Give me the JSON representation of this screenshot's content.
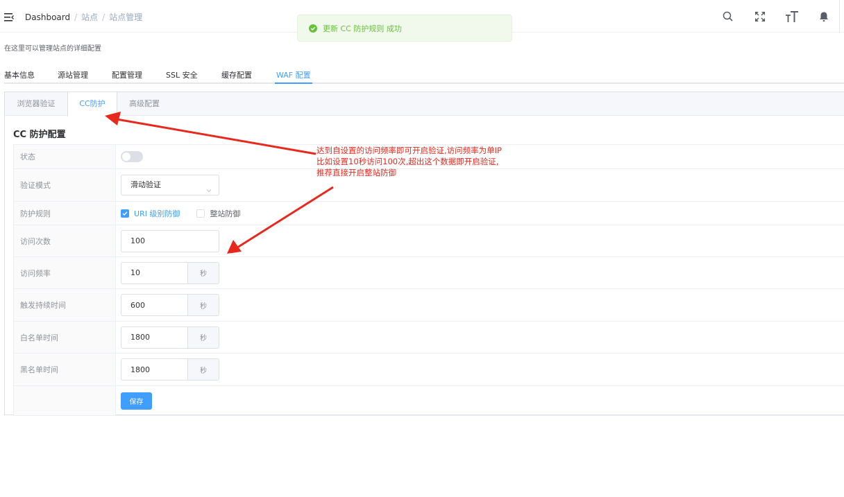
{
  "header": {
    "breadcrumb": [
      "Dashboard",
      "站点",
      "站点管理"
    ],
    "breadcrumb_separator": "/",
    "icons": [
      "search-icon",
      "fullscreen-icon",
      "font-size-icon",
      "bell-icon"
    ]
  },
  "toast": {
    "message": "更新 CC 防护规则 成功",
    "type": "success",
    "color": "#67c23a"
  },
  "page": {
    "description": "在这里可以管理站点的详细配置"
  },
  "top_tabs": {
    "items": [
      "基本信息",
      "源站管理",
      "配置管理",
      "SSL 安全",
      "缓存配置",
      "WAF 配置"
    ],
    "active": "WAF 配置"
  },
  "sub_tabs": {
    "items": [
      "浏览器验证",
      "CC防护",
      "高级配置"
    ],
    "active": "CC防护"
  },
  "section": {
    "title": "CC 防护配置"
  },
  "form": {
    "status": {
      "label": "状态",
      "enabled": false
    },
    "mode": {
      "label": "验证模式",
      "value": "滑动验证"
    },
    "rule": {
      "label": "防护规则",
      "options": [
        "URI 级别防御",
        "整站防御"
      ],
      "checked": "URI 级别防御"
    },
    "visits": {
      "label": "访问次数",
      "value": "100"
    },
    "frequency": {
      "label": "访问频率",
      "value": "10",
      "unit": "秒"
    },
    "trigger": {
      "label": "触发持续时间",
      "value": "600",
      "unit": "秒"
    },
    "whitelist": {
      "label": "白名单时间",
      "value": "1800",
      "unit": "秒"
    },
    "blacklist": {
      "label": "黑名单时间",
      "value": "1800",
      "unit": "秒"
    },
    "save_label": "保存"
  },
  "annotation": {
    "lines": [
      "达到自设置的访问频率即可开启验证,访问频率为单IP",
      "比如设置10秒访问100次,超出这个数据即开启验证,",
      "推荐直接开启整站防御"
    ],
    "color": "#e8281c"
  },
  "colors": {
    "primary": "#409eff",
    "success": "#67c23a",
    "annotation": "#e8281c"
  }
}
